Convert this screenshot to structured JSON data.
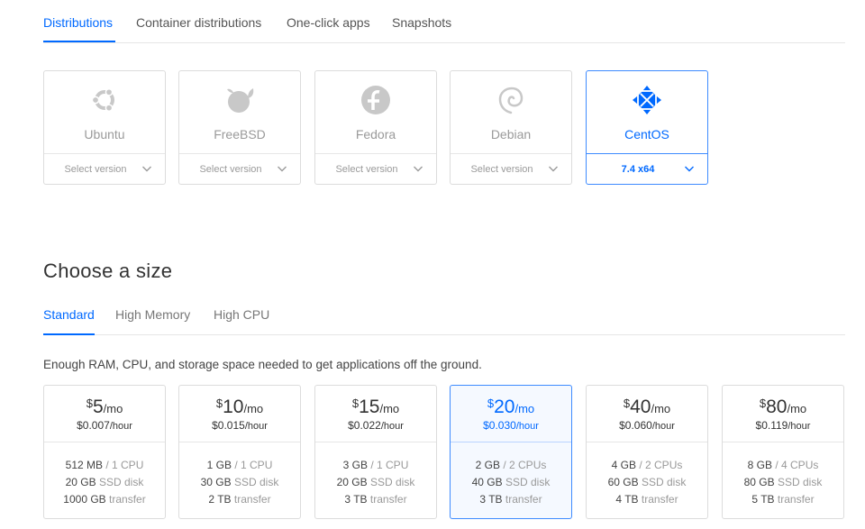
{
  "image_tabs": [
    {
      "label": "Distributions",
      "active": true
    },
    {
      "label": "Container distributions",
      "active": false
    },
    {
      "label": "One-click apps",
      "active": false
    },
    {
      "label": "Snapshots",
      "active": false
    }
  ],
  "distributions": [
    {
      "name": "Ubuntu",
      "icon": "ubuntu-icon",
      "version": "Select version",
      "selected": false
    },
    {
      "name": "FreeBSD",
      "icon": "freebsd-icon",
      "version": "Select version",
      "selected": false
    },
    {
      "name": "Fedora",
      "icon": "fedora-icon",
      "version": "Select version",
      "selected": false
    },
    {
      "name": "Debian",
      "icon": "debian-icon",
      "version": "Select version",
      "selected": false
    },
    {
      "name": "CentOS",
      "icon": "centos-icon",
      "version": "7.4 x64",
      "selected": true
    }
  ],
  "size_section": {
    "title": "Choose a size",
    "tabs": [
      {
        "label": "Standard",
        "active": true
      },
      {
        "label": "High Memory",
        "active": false
      },
      {
        "label": "High CPU",
        "active": false
      }
    ],
    "description": "Enough RAM, CPU, and storage space needed to get applications off the ground."
  },
  "plans": [
    {
      "currency": "$",
      "amount": "5",
      "per": "/mo",
      "hourly": "$0.007",
      "hour_unit": "/hour",
      "memory": "512 MB",
      "cpu": "/ 1 CPU",
      "disk": "20 GB",
      "disk_label": "SSD disk",
      "transfer": "1000 GB",
      "transfer_label": "transfer",
      "selected": false
    },
    {
      "currency": "$",
      "amount": "10",
      "per": "/mo",
      "hourly": "$0.015",
      "hour_unit": "/hour",
      "memory": "1 GB",
      "cpu": "/ 1 CPU",
      "disk": "30 GB",
      "disk_label": "SSD disk",
      "transfer": "2 TB",
      "transfer_label": "transfer",
      "selected": false
    },
    {
      "currency": "$",
      "amount": "15",
      "per": "/mo",
      "hourly": "$0.022",
      "hour_unit": "/hour",
      "memory": "3 GB",
      "cpu": "/ 1 CPU",
      "disk": "20 GB",
      "disk_label": "SSD disk",
      "transfer": "3 TB",
      "transfer_label": "transfer",
      "selected": false
    },
    {
      "currency": "$",
      "amount": "20",
      "per": "/mo",
      "hourly": "$0.030",
      "hour_unit": "/hour",
      "memory": "2 GB",
      "cpu": "/ 2 CPUs",
      "disk": "40 GB",
      "disk_label": "SSD disk",
      "transfer": "3 TB",
      "transfer_label": "transfer",
      "selected": true
    },
    {
      "currency": "$",
      "amount": "40",
      "per": "/mo",
      "hourly": "$0.060",
      "hour_unit": "/hour",
      "memory": "4 GB",
      "cpu": "/ 2 CPUs",
      "disk": "60 GB",
      "disk_label": "SSD disk",
      "transfer": "4 TB",
      "transfer_label": "transfer",
      "selected": false
    },
    {
      "currency": "$",
      "amount": "80",
      "per": "/mo",
      "hourly": "$0.119",
      "hour_unit": "/hour",
      "memory": "8 GB",
      "cpu": "/ 4 CPUs",
      "disk": "80 GB",
      "disk_label": "SSD disk",
      "transfer": "5 TB",
      "transfer_label": "transfer",
      "selected": false
    }
  ],
  "colors": {
    "accent": "#0069ff",
    "muted_text": "#9a9a9a",
    "border": "#dcdcdc"
  }
}
